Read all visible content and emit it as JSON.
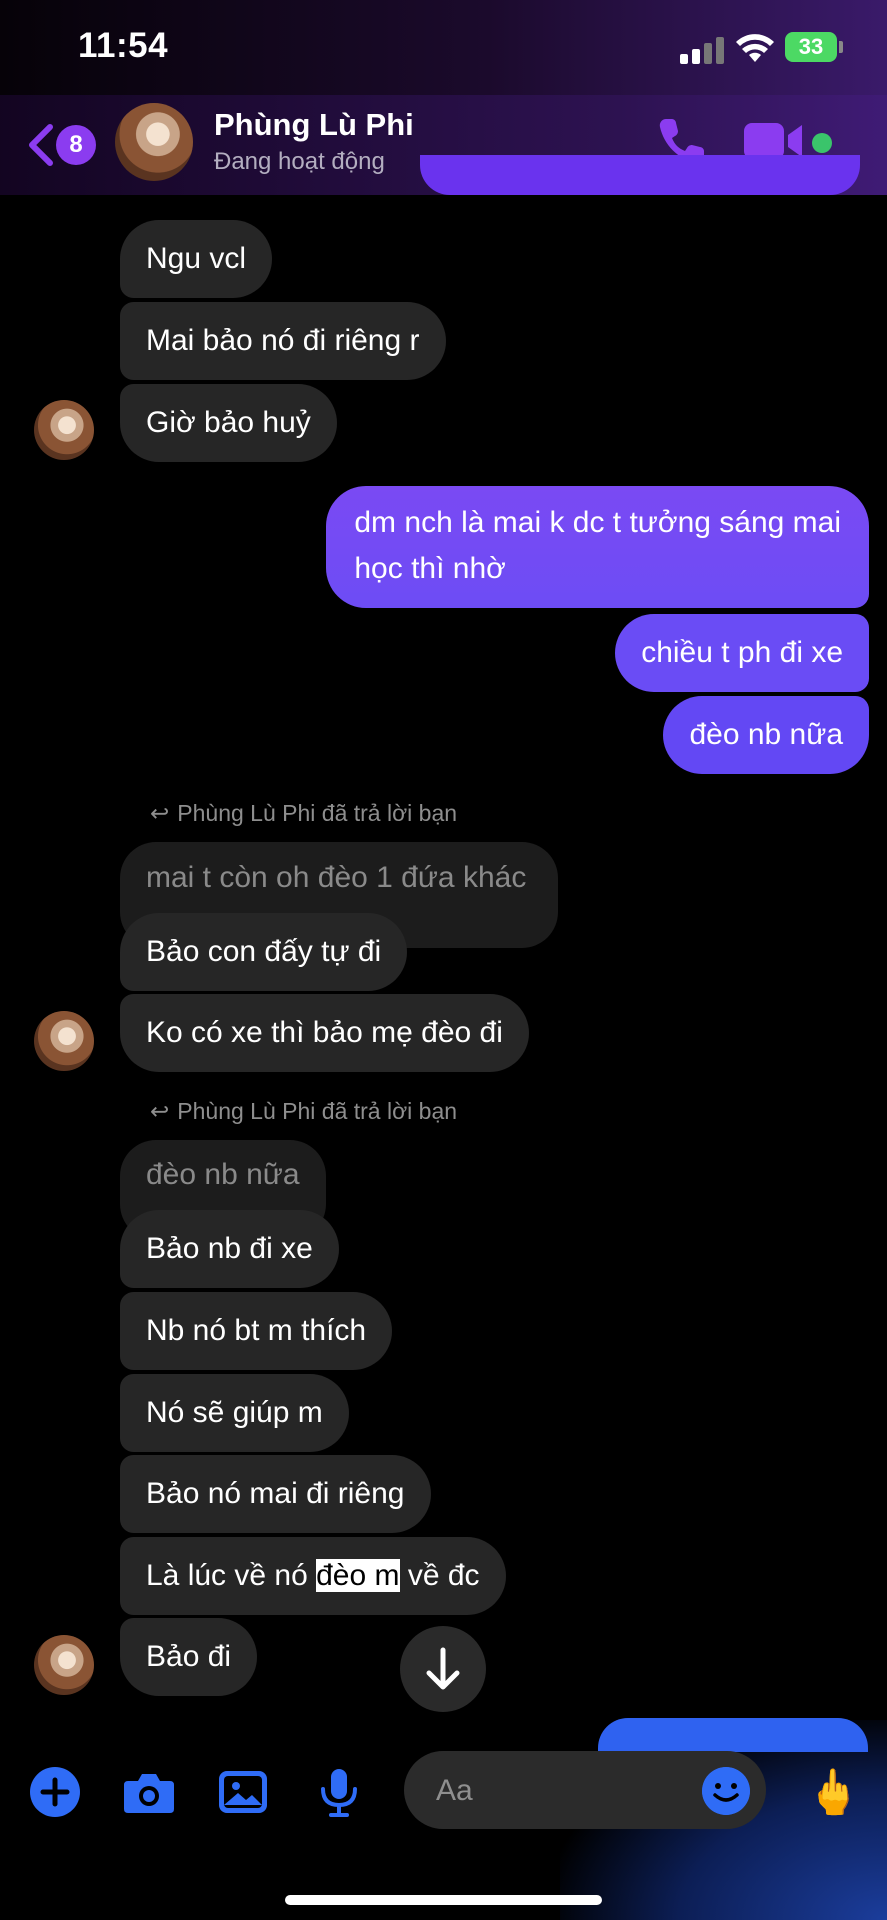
{
  "status_bar": {
    "time": "11:54",
    "battery": "33"
  },
  "header": {
    "back_badge": "8",
    "contact_name": "Phùng Lù Phi",
    "contact_status": "Đang hoạt động"
  },
  "messages": {
    "m1": "Ngu vcl",
    "m2": "Mai bảo nó đi riêng r",
    "m3": "Giờ bảo huỷ",
    "out1_line1": "dm nch là mai k dc t tưởng sáng mai",
    "out1_line2": "học thì nhờ",
    "out2": "chiều t ph đi xe",
    "out3": "đèo nb nữa",
    "reply_label_1": "Phùng Lù Phi đã trả lời bạn",
    "quoted_1": "mai t còn oh đèo 1 đứa khác",
    "m4": "Bảo con đấy tự đi",
    "m5": "Ko có xe thì bảo mẹ đèo đi",
    "reply_label_2": "Phùng Lù Phi đã trả lời bạn",
    "quoted_2": "đèo nb nữa",
    "m6": "Bảo nb đi xe",
    "m7": "Nb nó bt m thích",
    "m8": "Nó sẽ giúp m",
    "m9": "Bảo nó mai đi riêng",
    "m10_before": "Là lúc về nó ",
    "m10_highlight": "đèo m",
    "m10_after": " về đc",
    "m11": "Bảo đi"
  },
  "composer": {
    "placeholder": "Aa",
    "gesture": "🖕"
  },
  "colors": {
    "outgoing_bubble": "#6a4cf5",
    "incoming_bubble": "#262626",
    "accent": "#8b3cf0",
    "tool_blue": "#2f6cf6"
  }
}
